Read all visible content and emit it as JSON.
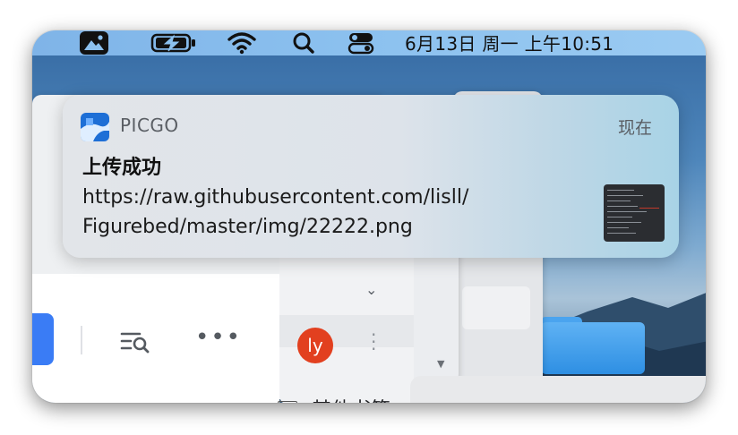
{
  "menubar": {
    "clock": "6月13日 周一 上午10:51",
    "icons": [
      "photos-icon",
      "battery-charging-icon",
      "wifi-icon",
      "spotlight-search-icon",
      "control-center-icon"
    ],
    "colors": {
      "bar": "#8cc1ef"
    }
  },
  "notification": {
    "app_name": "PICGO",
    "time": "现在",
    "title": "上传成功",
    "body_line1": "https://raw.githubusercontent.com/lisll/",
    "body_line2": "Figurebed/master/img/22222.png"
  },
  "browser": {
    "avatar_initials": "ly",
    "bookmarks_folder": "其他书签",
    "accent": "#3a7cf5",
    "avatar_color": "#e2401f"
  }
}
